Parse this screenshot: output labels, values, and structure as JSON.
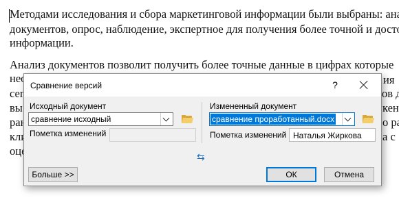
{
  "document": {
    "lines": [
      "Методами исследования и сбора маркетинговой информации были выбраны: анали",
      "документов, опрос, наблюдение, экспертное для получения более точной и достове",
      "информации.",
      "Анализ документов позволит получить более точные данные в цифрах которые",
      "нео",
      "сег",
      "вы",
      "ран",
      "кли",
      "оце"
    ],
    "right_fragments": [
      "ия",
      "ов д",
      "кенн",
      "о ра",
      "а с"
    ]
  },
  "dialog": {
    "title": "Сравнение версий",
    "help": "?",
    "original": {
      "label": "Исходный документ",
      "value": "сравнение исходный",
      "marks_label": "Пометка изменений",
      "marks_value": ""
    },
    "revised": {
      "label": "Измененный документ",
      "value": "сравнение проработанный.docx",
      "marks_label": "Пометка изменений",
      "marks_value": "Наталья Жиркова"
    },
    "swap_glyph": "⇆",
    "more_button": "Больше >>",
    "ok_button": "ОК",
    "cancel_button": "Отмена"
  },
  "colors": {
    "selection": "#0078d7",
    "folder": "#d9a73b",
    "swap_arrows": "#1e6fc5"
  },
  "icons": [
    "folder-icon",
    "swap-icon",
    "close-icon",
    "help-icon",
    "chevron-down-icon"
  ]
}
